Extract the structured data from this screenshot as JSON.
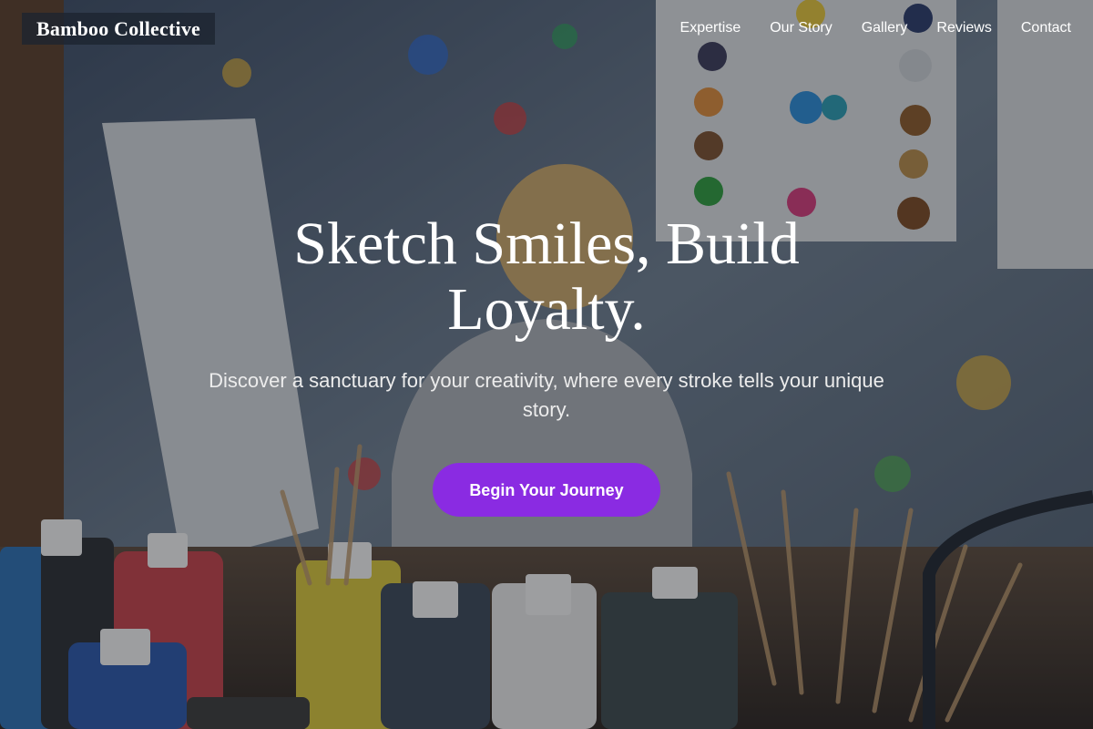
{
  "header": {
    "brand": "Bamboo Collective",
    "nav": [
      "Expertise",
      "Our Story",
      "Gallery",
      "Reviews",
      "Contact"
    ]
  },
  "hero": {
    "headline": "Sketch Smiles, Build Loyalty.",
    "subtext": "Discover a sanctuary for your creativity, where every stroke tells your unique story.",
    "cta_label": "Begin Your Journey",
    "background_image": "art-studio-paint-bottles-photo"
  },
  "colors": {
    "cta": "#8a2be2",
    "brand_bg": "#1c2430",
    "text": "#ffffff"
  }
}
